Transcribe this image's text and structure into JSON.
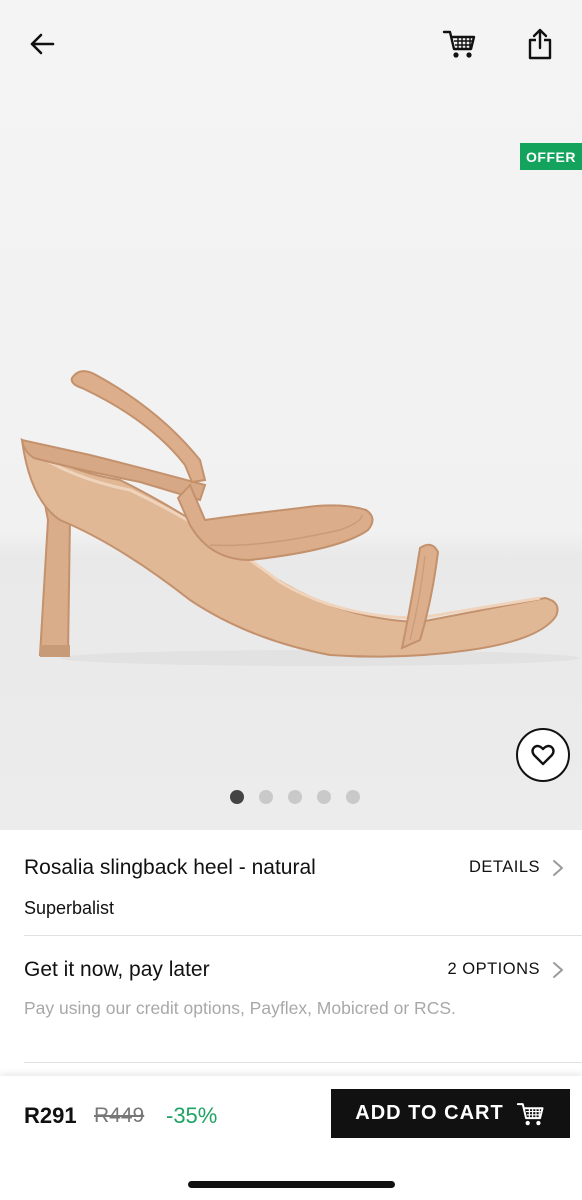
{
  "header": {
    "back_icon": "arrow-left-icon",
    "cart_icon": "shopping-cart-icon",
    "share_icon": "share-icon"
  },
  "gallery": {
    "offer_badge": "OFFER",
    "wishlist_icon": "heart-icon",
    "image_count": 5,
    "active_index": 0,
    "product_color": "#d9ac8a"
  },
  "product": {
    "title": "Rosalia slingback heel - natural",
    "brand": "Superbalist",
    "details_label": "DETAILS"
  },
  "payment": {
    "title": "Get it now, pay later",
    "options_label": "2 OPTIONS",
    "subtitle": "Pay using our credit options, Payflex, Mobicred or RCS."
  },
  "purchase": {
    "price": "R291",
    "old_price": "R449",
    "discount": "-35%",
    "add_to_cart_label": "ADD TO CART"
  },
  "colors": {
    "accent_green": "#13a35c",
    "discount_green": "#1fa363",
    "button_black": "#111111"
  }
}
